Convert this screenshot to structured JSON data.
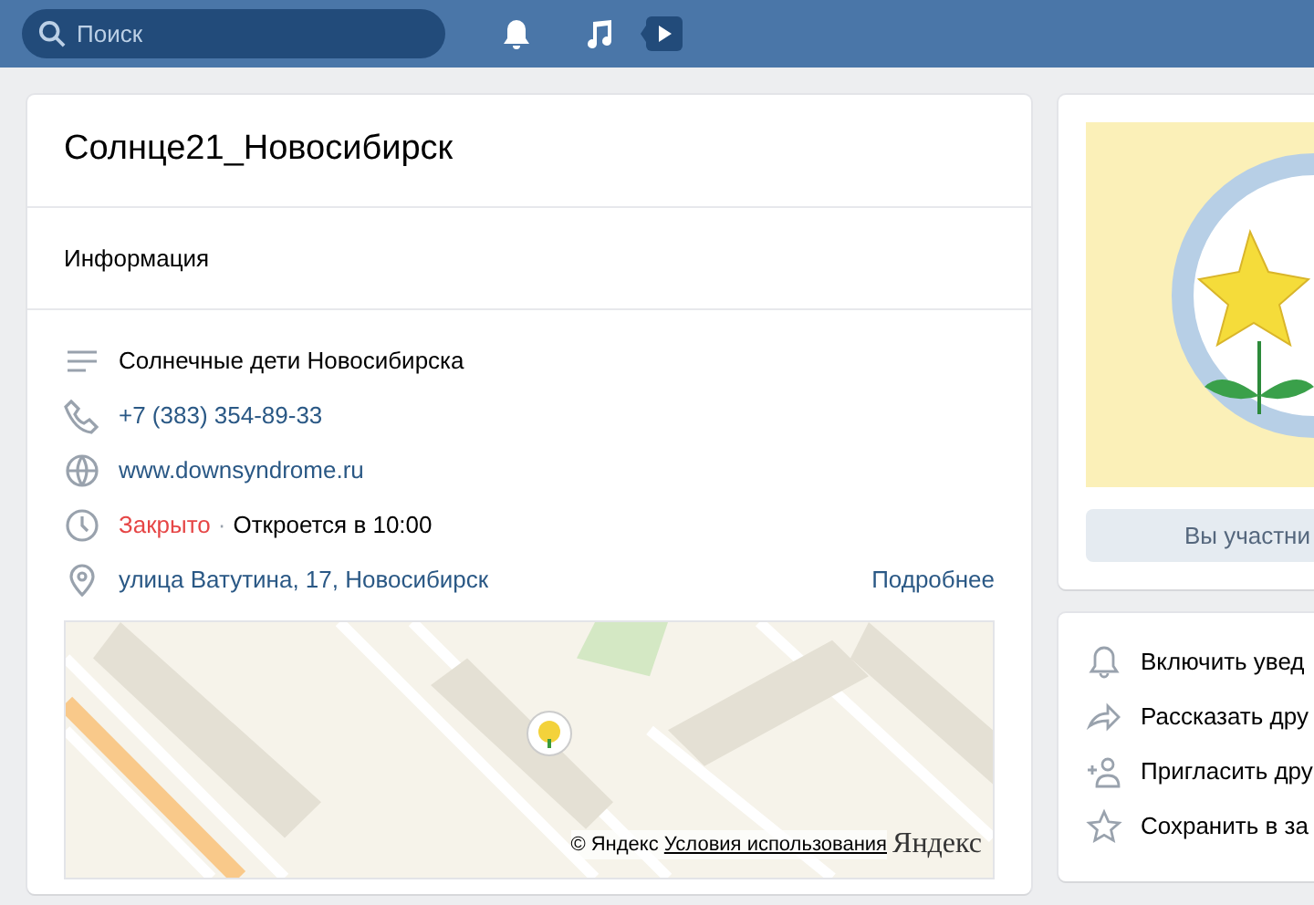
{
  "topbar": {
    "search": {
      "placeholder": "Поиск"
    }
  },
  "group": {
    "title": "Солнце21_Новосибирск",
    "section": "Информация",
    "info": [
      {
        "kind": "description",
        "text": "Солнечные дети Новосибирска"
      },
      {
        "kind": "phone",
        "text": "+7 (383) 354-89-33"
      },
      {
        "kind": "site",
        "text": "www.downsyndrome.ru"
      },
      {
        "kind": "hours",
        "status": "Закрыто",
        "separator": "·",
        "text": "Откроется в 10:00"
      },
      {
        "kind": "address",
        "text": "улица Ватутина, 17, Новосибирск",
        "more": "Подробнее"
      }
    ],
    "map": {
      "copyright": "© Яндекс",
      "terms": "Условия использования",
      "logo": "Яндекс"
    }
  },
  "side": {
    "member_button": "Вы участни",
    "actions": [
      {
        "kind": "bell",
        "label": "Включить увед"
      },
      {
        "kind": "share",
        "label": "Рассказать дру"
      },
      {
        "kind": "invite",
        "label": "Пригласить дру"
      },
      {
        "kind": "star",
        "label": "Сохранить в за"
      }
    ]
  }
}
